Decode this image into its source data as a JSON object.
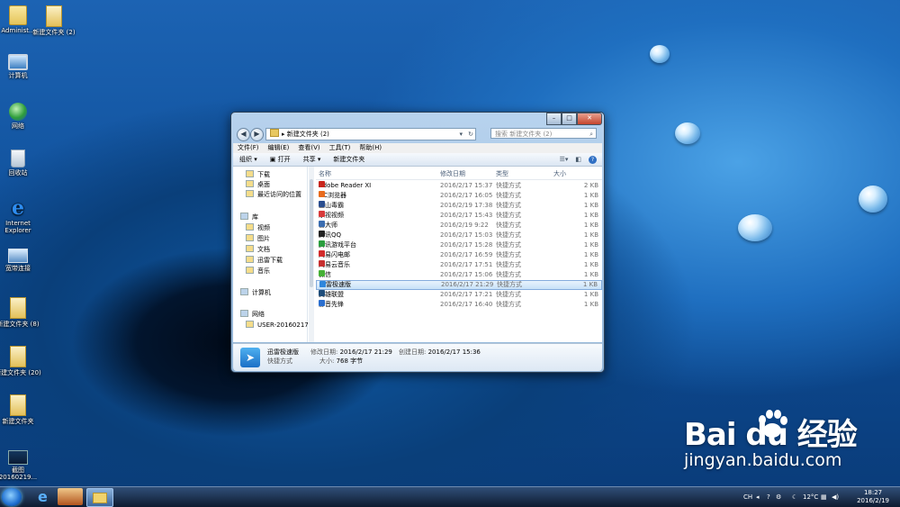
{
  "desktop": {
    "icons": [
      {
        "label": "Administ..."
      },
      {
        "label": "新建文件夹 (2)"
      },
      {
        "label": "计算机"
      },
      {
        "label": "网络"
      },
      {
        "label": "回收站"
      },
      {
        "label": "Internet Explorer"
      },
      {
        "label": "宽带连接"
      },
      {
        "label": "新建文件夹 (8)"
      },
      {
        "label": "新建文件夹 (20)"
      },
      {
        "label": "新建文件夹"
      },
      {
        "label": "截图 20160219..."
      }
    ]
  },
  "window": {
    "address": "新建文件夹 (2)",
    "search_placeholder": "搜索 新建文件夹 (2)",
    "menu": [
      "文件(F)",
      "编辑(E)",
      "查看(V)",
      "工具(T)",
      "帮助(H)"
    ],
    "toolbar": {
      "organize": "组织 ▾",
      "open": "打开",
      "share": "共享 ▾",
      "new_folder": "新建文件夹"
    },
    "nav": [
      {
        "label": "下载"
      },
      {
        "label": "桌面"
      },
      {
        "label": "最近访问的位置"
      },
      {
        "label": "库"
      },
      {
        "label": "视频"
      },
      {
        "label": "图片"
      },
      {
        "label": "文档"
      },
      {
        "label": "迅雷下载"
      },
      {
        "label": "音乐"
      },
      {
        "label": "计算机"
      },
      {
        "label": "网络"
      },
      {
        "label": "USER-20160217"
      }
    ],
    "columns": {
      "name": "名称",
      "modified": "修改日期",
      "type": "类型",
      "size": "大小"
    },
    "files": [
      {
        "name": "Adobe Reader XI",
        "date": "2016/2/17 15:37",
        "type": "快捷方式",
        "size": "2 KB",
        "color": "#c8261c"
      },
      {
        "name": "UC浏览器",
        "date": "2016/2/17 16:05",
        "type": "快捷方式",
        "size": "1 KB",
        "color": "#e86a1c"
      },
      {
        "name": "金山毒霸",
        "date": "2016/2/19 17:38",
        "type": "快捷方式",
        "size": "1 KB",
        "color": "#2a4d8f"
      },
      {
        "name": "乐视视频",
        "date": "2016/2/17 15:43",
        "type": "快捷方式",
        "size": "1 KB",
        "color": "#d83b3b"
      },
      {
        "name": "鲁大师",
        "date": "2016/2/19 9:22",
        "type": "快捷方式",
        "size": "1 KB",
        "color": "#3b6db0"
      },
      {
        "name": "腾讯QQ",
        "date": "2016/2/17 15:03",
        "type": "快捷方式",
        "size": "1 KB",
        "color": "#222222"
      },
      {
        "name": "腾讯游戏平台",
        "date": "2016/2/17 15:28",
        "type": "快捷方式",
        "size": "1 KB",
        "color": "#2a9d3e"
      },
      {
        "name": "网易闪电邮",
        "date": "2016/2/17 16:59",
        "type": "快捷方式",
        "size": "1 KB",
        "color": "#d22a2a"
      },
      {
        "name": "网易云音乐",
        "date": "2016/2/17 17:51",
        "type": "快捷方式",
        "size": "1 KB",
        "color": "#c62f2f"
      },
      {
        "name": "微信",
        "date": "2016/2/17 15:06",
        "type": "快捷方式",
        "size": "1 KB",
        "color": "#45b035"
      },
      {
        "name": "迅雷极速版",
        "date": "2016/2/17 21:29",
        "type": "快捷方式",
        "size": "1 KB",
        "color": "#2f86dc",
        "selected": true
      },
      {
        "name": "英雄联盟",
        "date": "2016/2/17 17:21",
        "type": "快捷方式",
        "size": "1 KB",
        "color": "#1f4d7a"
      },
      {
        "name": "影音先锋",
        "date": "2016/2/17 16:40",
        "type": "快捷方式",
        "size": "1 KB",
        "color": "#2b6fcf"
      }
    ],
    "details": {
      "name": "迅雷极速版",
      "kind": "快捷方式",
      "modified_label": "修改日期:",
      "modified": "2016/2/17 21:29",
      "created_label": "创建日期:",
      "created": "2016/2/17 15:36",
      "size_label": "大小:",
      "size": "768 字节"
    }
  },
  "taskbar": {
    "lang": "CH",
    "weather": "12°C",
    "time": "18:27",
    "date": "2016/2/19"
  },
  "watermark": {
    "logo": "Bai  du 经验",
    "url": "jingyan.baidu.com"
  }
}
